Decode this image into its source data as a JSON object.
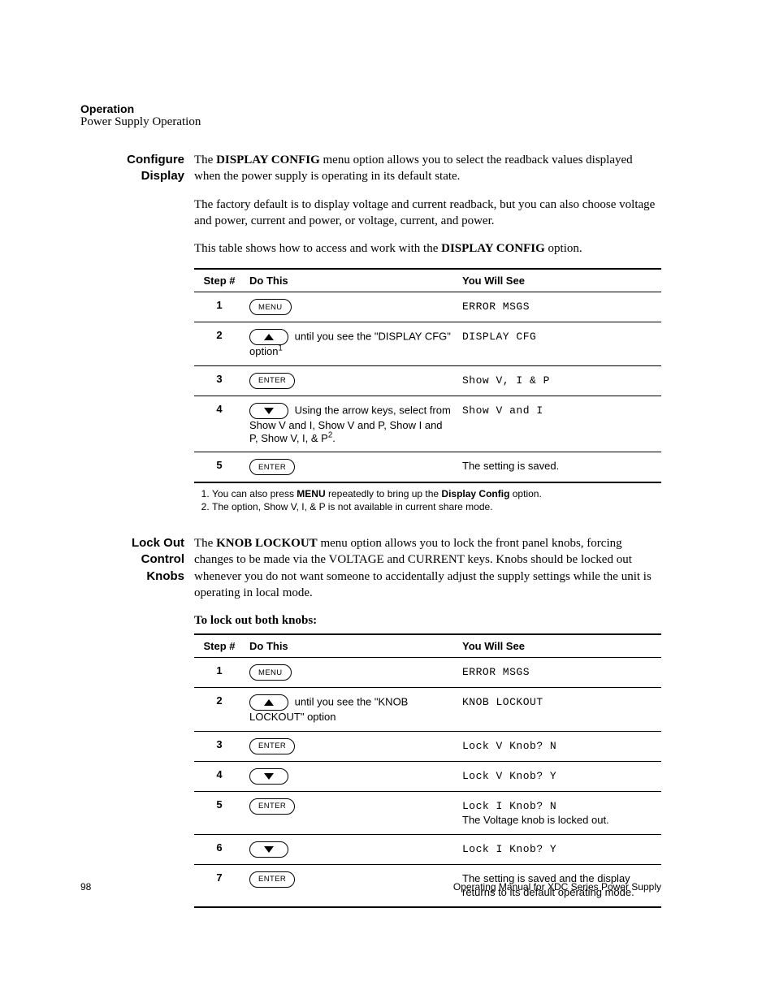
{
  "running_head": {
    "line1": "Operation",
    "line2": "Power Supply Operation"
  },
  "section1": {
    "heading_line1": "Configure",
    "heading_line2": "Display",
    "para1_a": "The ",
    "para1_bold": "DISPLAY CONFIG",
    "para1_b": " menu option allows you to select the readback values displayed when the power supply is operating in its default state.",
    "para2": "The factory default is to display voltage and current readback, but you can also choose voltage and power, current and power, or voltage, current, and power.",
    "para3_a": "This table shows how to access and work with the ",
    "para3_bold": "DISPLAY CONFIG",
    "para3_b": " option."
  },
  "table_headers": {
    "step": "Step #",
    "dothis": "Do This",
    "see": "You Will See"
  },
  "icons": {
    "menu": "MENU",
    "enter": "ENTER",
    "up": "▲",
    "down": "▼"
  },
  "table1": {
    "rows": [
      {
        "n": "1",
        "btn": "menu",
        "text": "",
        "see_mono": "ERROR MSGS",
        "see_text": ""
      },
      {
        "n": "2",
        "btn": "up",
        "text_a": " until you see the \"DISPLAY CFG\" option",
        "fn": "1",
        "see_mono": "DISPLAY CFG",
        "see_text": ""
      },
      {
        "n": "3",
        "btn": "enter",
        "text": "",
        "see_mono": "Show V, I & P",
        "see_text": ""
      },
      {
        "n": "4",
        "btn": "down",
        "text_a": " Using the arrow keys, select from Show V and I, Show V and P, Show I and P, Show V, I, & P",
        "fn": "2",
        "text_b": ".",
        "see_mono": "Show V and I",
        "see_text": ""
      },
      {
        "n": "5",
        "btn": "enter",
        "text": "",
        "see_mono": "",
        "see_text": "The setting is saved."
      }
    ],
    "footnotes": [
      {
        "pre": "You can also press ",
        "b1": "MENU",
        "mid": " repeatedly to bring up the ",
        "b2": "Display Config",
        "post": " option."
      },
      {
        "text": "The option, Show V, I, & P is not available in current share mode."
      }
    ]
  },
  "section2": {
    "heading_line1": "Lock Out",
    "heading_line2": "Control",
    "heading_line3": "Knobs",
    "para1_a": "The ",
    "para1_bold": "KNOB LOCKOUT",
    "para1_b": " menu option allows you to lock the front panel knobs, forcing changes to be made via the VOLTAGE and CURRENT keys. Knobs should be locked out whenever you do not want someone to accidentally adjust the supply settings while the unit is operating in local mode.",
    "subhead": "To lock out both knobs:"
  },
  "table2": {
    "rows": [
      {
        "n": "1",
        "btn": "menu",
        "text": "",
        "see_mono": "ERROR MSGS",
        "see_text": ""
      },
      {
        "n": "2",
        "btn": "up",
        "text": " until you see the \"KNOB LOCKOUT\" option",
        "see_mono": "KNOB LOCKOUT",
        "see_text": ""
      },
      {
        "n": "3",
        "btn": "enter",
        "text": "",
        "see_mono": "Lock V Knob? N",
        "see_text": ""
      },
      {
        "n": "4",
        "btn": "down",
        "text": "",
        "see_mono": "Lock V Knob? Y",
        "see_text": ""
      },
      {
        "n": "5",
        "btn": "enter",
        "text": "",
        "see_mono": "Lock I Knob? N",
        "see_text": "The Voltage knob is locked out."
      },
      {
        "n": "6",
        "btn": "down",
        "text": "",
        "see_mono": "Lock I Knob? Y",
        "see_text": ""
      },
      {
        "n": "7",
        "btn": "enter",
        "text": "",
        "see_mono": "",
        "see_text": "The setting is saved and the display returns to its default operating mode."
      }
    ]
  },
  "footer": {
    "page": "98",
    "title": "Operating Manual for XDC Series Power Supply"
  }
}
